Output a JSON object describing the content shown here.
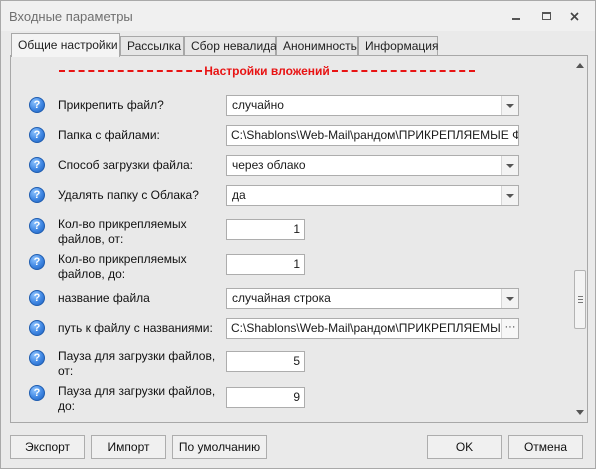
{
  "window": {
    "title": "Входные параметры"
  },
  "tabs": [
    {
      "label": "Общие настройки"
    },
    {
      "label": "Рассылка"
    },
    {
      "label": "Сбор невалида"
    },
    {
      "label": "Анонимность"
    },
    {
      "label": "Информация"
    }
  ],
  "section": {
    "title": "Настройки вложений"
  },
  "fields": [
    {
      "label": "Прикрепить файл?",
      "value": "случайно"
    },
    {
      "label": "Папка с файлами:",
      "value": "C:\\Shablons\\Web-Mail\\рандом\\ПРИКРЕПЛЯЕМЫЕ ФАЙЛЫ"
    },
    {
      "label": "Способ загрузки файла:",
      "value": "через облако"
    },
    {
      "label": "Удалять папку с Облака?",
      "value": "да"
    },
    {
      "label": "Кол-во прикрепляемых файлов, от:",
      "value": "1"
    },
    {
      "label": "Кол-во прикрепляемых файлов, до:",
      "value": "1"
    },
    {
      "label": "название файла",
      "value": "случайная строка"
    },
    {
      "label": "путь к файлу с названиями:",
      "value": "C:\\Shablons\\Web-Mail\\рандом\\ПРИКРЕПЛЯЕМЫЕ ФАЙЛ"
    },
    {
      "label": "Пауза для загрузки файлов, от:",
      "value": "5"
    },
    {
      "label": "Пауза для загрузки файлов, до:",
      "value": "9"
    }
  ],
  "help_icon_glyph": "?",
  "buttons": {
    "export": "Экспорт",
    "import": "Импорт",
    "defaults": "По умолчанию",
    "ok": "OK",
    "cancel": "Отмена"
  },
  "icons": {
    "minimize": "minimize-icon",
    "restore": "restore-icon",
    "close": "close-icon",
    "help": "help-icon",
    "dropdown": "chevron-down-icon",
    "browse": "ellipsis-icon"
  }
}
